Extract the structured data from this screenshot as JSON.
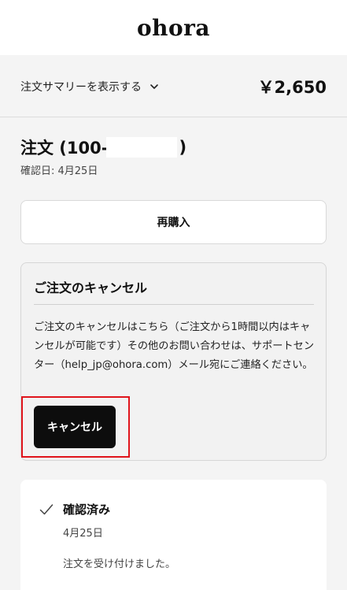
{
  "header": {
    "logo_text": "ohora"
  },
  "summary": {
    "toggle_label": "注文サマリーを表示する",
    "total": "￥2,650",
    "toggle_icon": "chevron-down-icon"
  },
  "order": {
    "title_prefix": "注文 (100-",
    "title_suffix": ")",
    "confirm_date": "確認日: 4月25日"
  },
  "rebuy": {
    "label": "再購入"
  },
  "cancel": {
    "title": "ご注文のキャンセル",
    "body": "ご注文のキャンセルはこちら（ご注文から1時間以内はキャンセルが可能です）その他のお問い合わせは、サポートセンター（help_jp@ohora.com）メール宛にご連絡ください。",
    "button_label": "キャンセル",
    "highlight_color": "#e0141b"
  },
  "status": {
    "icon": "checkmark-icon",
    "title": "確認済み",
    "date": "4月25日",
    "message": "注文を受け付けました。"
  }
}
